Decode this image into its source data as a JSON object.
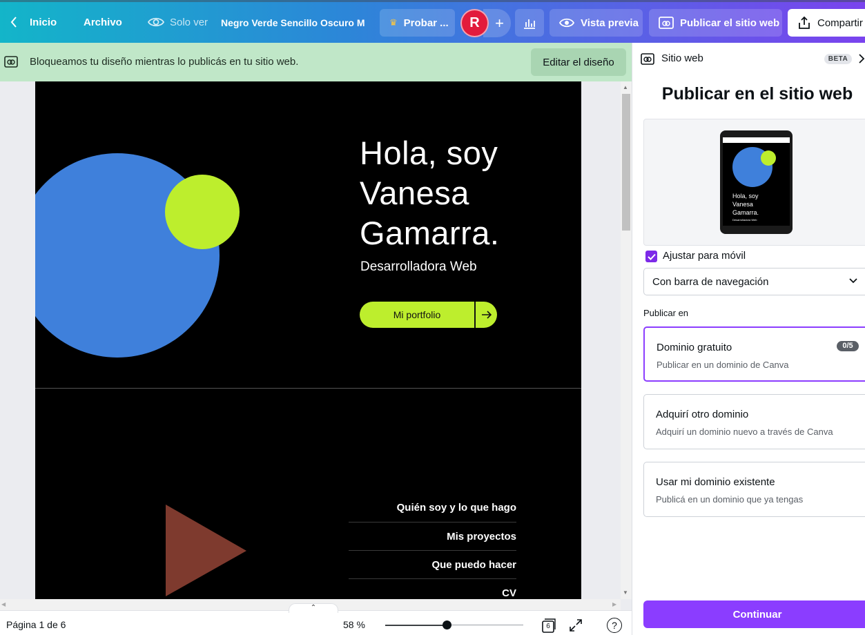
{
  "topbar": {
    "home_label": "Inicio",
    "file_label": "Archivo",
    "view_mode_label": "Solo ver",
    "doc_title": "Negro Verde Sencillo Oscuro M",
    "try_pro_label": "Probar ...",
    "avatar_initial": "R",
    "preview_label": "Vista previa",
    "publish_label": "Publicar el sitio web",
    "share_label": "Compartir"
  },
  "banner": {
    "message": "Bloqueamos tu diseño mientras lo publicás en tu sitio web.",
    "edit_label": "Editar el diseño"
  },
  "design": {
    "hero_title_lines": [
      "Hola, soy",
      "Vanesa",
      "Gamarra."
    ],
    "hero_subtitle": "Desarrolladora Web",
    "cta_label": "Mi portfolio",
    "nav_links": [
      "Quién soy y lo que hago",
      "Mis proyectos",
      "Que puedo hacer",
      "CV"
    ],
    "colors": {
      "blue_circle": "#3f80db",
      "lime": "#bdee2d",
      "triangle": "#7e3a2e",
      "background": "#000000"
    }
  },
  "footer": {
    "page_indicator": "Página 1 de 6",
    "zoom": "58 %",
    "zoom_value": 0.44,
    "pages_count": "6",
    "help_icon": "?"
  },
  "panel": {
    "header_label": "Sitio web",
    "beta_label": "BETA",
    "title": "Publicar en el sitio web",
    "preview": {
      "title_lines": [
        "Hola, soy",
        "Vanesa",
        "Gamarra."
      ],
      "subtitle": "Desarrolladora Web"
    },
    "mobile_checkbox_label": "Ajustar para móvil",
    "mobile_checked": true,
    "nav_select_value": "Con barra de navegación",
    "publish_in_label": "Publicar en",
    "options": [
      {
        "title": "Dominio gratuito",
        "subtitle": "Publicar en un dominio de Canva",
        "badge": "0/5",
        "selected": true
      },
      {
        "title": "Adquirí otro dominio",
        "subtitle": "Adquirí un dominio nuevo a través de Canva",
        "selected": false
      },
      {
        "title": "Usar mi dominio existente",
        "subtitle": "Publicá en un dominio que ya tengas",
        "selected": false
      }
    ],
    "continue_label": "Continuar",
    "accent_color": "#8b3dff"
  }
}
